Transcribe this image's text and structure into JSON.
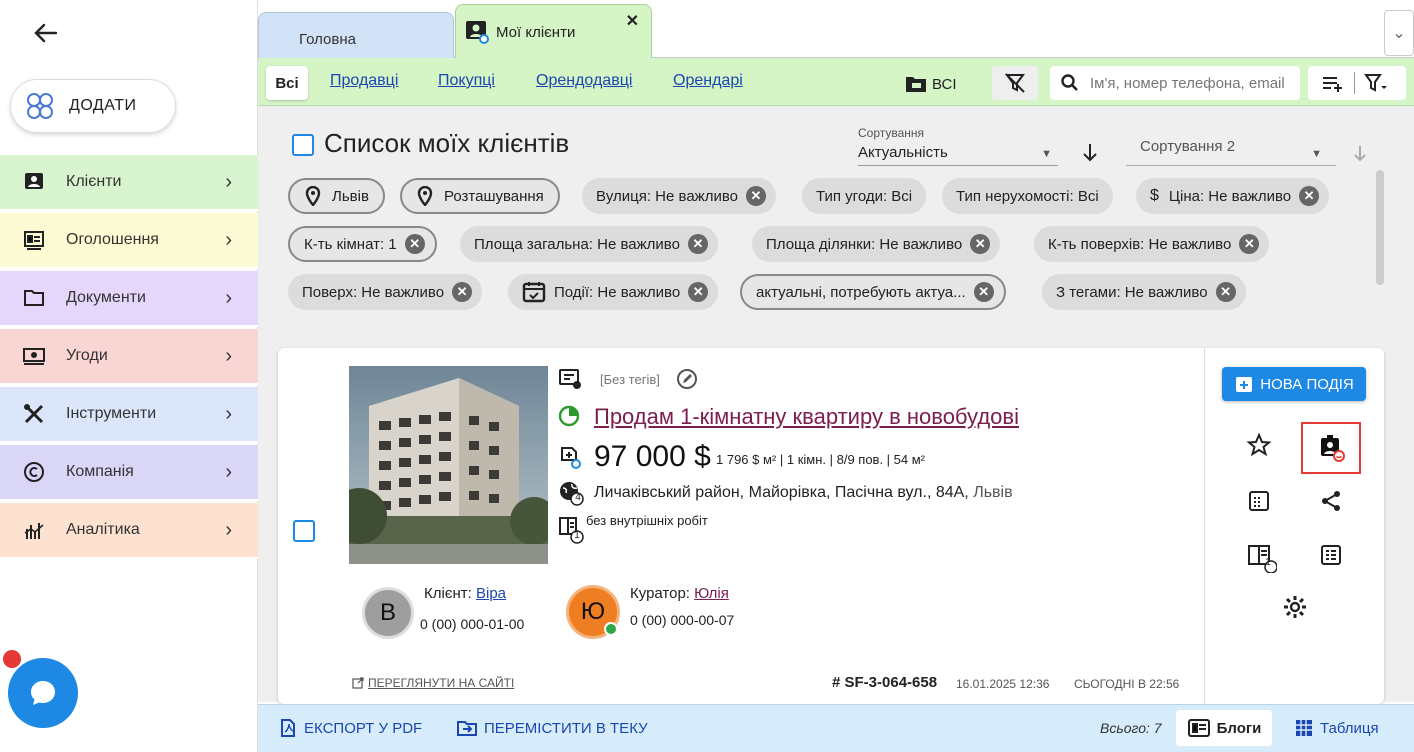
{
  "sidebar": {
    "add_label": "ДОДАТИ",
    "items": [
      {
        "label": "Клієнти",
        "color": "#d9f5cf",
        "icon": "clients-icon"
      },
      {
        "label": "Оголошення",
        "color": "#fdfbd3",
        "icon": "listing-icon"
      },
      {
        "label": "Документи",
        "color": "#e4d7fb",
        "icon": "folder-icon"
      },
      {
        "label": "Угоди",
        "color": "#f9d6d3",
        "icon": "money-icon"
      },
      {
        "label": "Інструменти",
        "color": "#dbe6fb",
        "icon": "tools-icon"
      },
      {
        "label": "Компанія",
        "color": "#d9d6f8",
        "icon": "copyright-icon"
      },
      {
        "label": "Аналітика",
        "color": "#fde3cf",
        "icon": "analytics-icon"
      }
    ]
  },
  "tabs": {
    "home": "Головна",
    "clients": "Мої клієнти"
  },
  "filters": {
    "all": "Всі",
    "links": [
      "Продавці",
      "Покупці",
      "Орендодавці",
      "Орендарі"
    ],
    "folder_label": "ВСІ",
    "search_placeholder": "Ім'я, номер телефона, email"
  },
  "list": {
    "title": "Список моїх клієнтів",
    "sort_label": "Сортування",
    "sort_value": "Актуальність",
    "sort2_label": "Сортування 2"
  },
  "chips": [
    {
      "label": "Львів",
      "outlined": true,
      "pin": true,
      "x": false
    },
    {
      "label": "Розташування",
      "outlined": true,
      "pin": true,
      "x": false
    },
    {
      "label": "Вулиця: Не важливо",
      "x": true
    },
    {
      "label": "Тип угоди: Всі",
      "x": false
    },
    {
      "label": "Тип нерухомості: Всі",
      "x": false
    },
    {
      "label": "Ціна: Не важливо",
      "x": true,
      "dollar": true
    },
    {
      "label": "К-ть кімнат: 1",
      "outlined": true,
      "x": true
    },
    {
      "label": "Площа загальна: Не важливо",
      "x": true
    },
    {
      "label": "Площа ділянки: Не важливо",
      "x": true
    },
    {
      "label": "К-ть поверхів: Не важливо",
      "x": true
    },
    {
      "label": "Поверх: Не важливо",
      "x": true
    },
    {
      "label": "Події: Не важливо",
      "x": true,
      "cal": true
    },
    {
      "label": "актуальні, потребують актуа...",
      "outlined": true,
      "x": true
    },
    {
      "label": "З тегами: Не важливо",
      "x": true
    }
  ],
  "card": {
    "tags": "[Без тегів]",
    "title": "Продам 1-кімнатну квартиру в новобудові",
    "price": "97 000 $",
    "details": "1 796 $ м² | 1 кімн. | 8/9 пов. | 54 м²",
    "address": "Личаківський район, Майорівка, Пасічна вул., 84А,",
    "city": "Львів",
    "badge4": "4",
    "note": "без внутрішніх робіт",
    "note_badge": "1",
    "client_label": "Клієнт:",
    "client_name": "Віра",
    "client_initial": "В",
    "client_phone": "0 (00) 000-01-00",
    "curator_label": "Куратор:",
    "curator_name": "Юлія",
    "curator_initial": "Ю",
    "curator_phone": "0 (00) 000-00-07",
    "view_site": "ПЕРЕГЛЯНУТИ НА САЙТІ",
    "id": "# SF-3-064-658",
    "created": "16.01.2025 12:36",
    "updated": "СЬОГОДНІ В 22:56",
    "new_event": "НОВА ПОДІЯ",
    "actions_badge": "1"
  },
  "footer": {
    "export": "ЕКСПОРТ У PDF",
    "move": "ПЕРЕМІСТИТИ В ТЕКУ",
    "total": "Всього: 7",
    "blogs": "Блоги",
    "table": "Таблиця"
  },
  "colors": {
    "accent": "#1e88e5",
    "link": "#1a47b0",
    "title_link": "#7b1d4d",
    "green": "#2e9a2e",
    "orange": "#ef7d22"
  }
}
